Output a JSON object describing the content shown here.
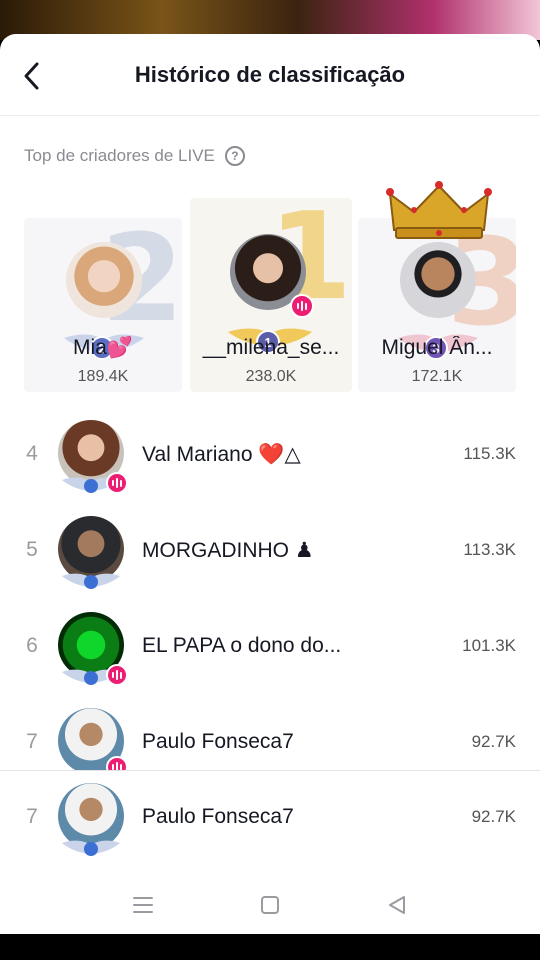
{
  "header": {
    "title": "Histórico de classificação",
    "back_icon": "chevron-left-icon"
  },
  "section": {
    "label": "Top de criadores de LIVE",
    "help_symbol": "?"
  },
  "podium": [
    {
      "rank_label": "2",
      "big_number": "2",
      "name": "Mia💕",
      "score": "189.4K",
      "live": false
    },
    {
      "rank_label": "1",
      "big_number": "1",
      "name": "__milena_se...",
      "score": "238.0K",
      "live": true
    },
    {
      "rank_label": "3",
      "big_number": "3",
      "name": "Miguel Ân...",
      "score": "172.1K",
      "live": false,
      "crown_icon": "gold-crown-icon"
    }
  ],
  "list": [
    {
      "rank": "4",
      "name": "Val Mariano ❤️△",
      "score": "115.3K",
      "live": true
    },
    {
      "rank": "5",
      "name": "MORGADINHO ♟",
      "score": "113.3K",
      "live": false
    },
    {
      "rank": "6",
      "name": "EL PAPA o dono do...",
      "score": "101.3K",
      "live": true
    },
    {
      "rank": "7",
      "name": "Paulo Fonseca7",
      "score": "92.7K",
      "live": true
    }
  ],
  "current_user": {
    "rank": "7",
    "name": "Paulo Fonseca7",
    "score": "92.7K"
  },
  "navbar": {
    "menu_icon": "menu-icon",
    "home_icon": "square-home-icon",
    "back_icon": "triangle-back-icon"
  },
  "colors": {
    "live_pink": "#ee1d74",
    "gold": "#f1d58a",
    "text_primary": "#161823",
    "text_secondary": "#8a8b91"
  }
}
